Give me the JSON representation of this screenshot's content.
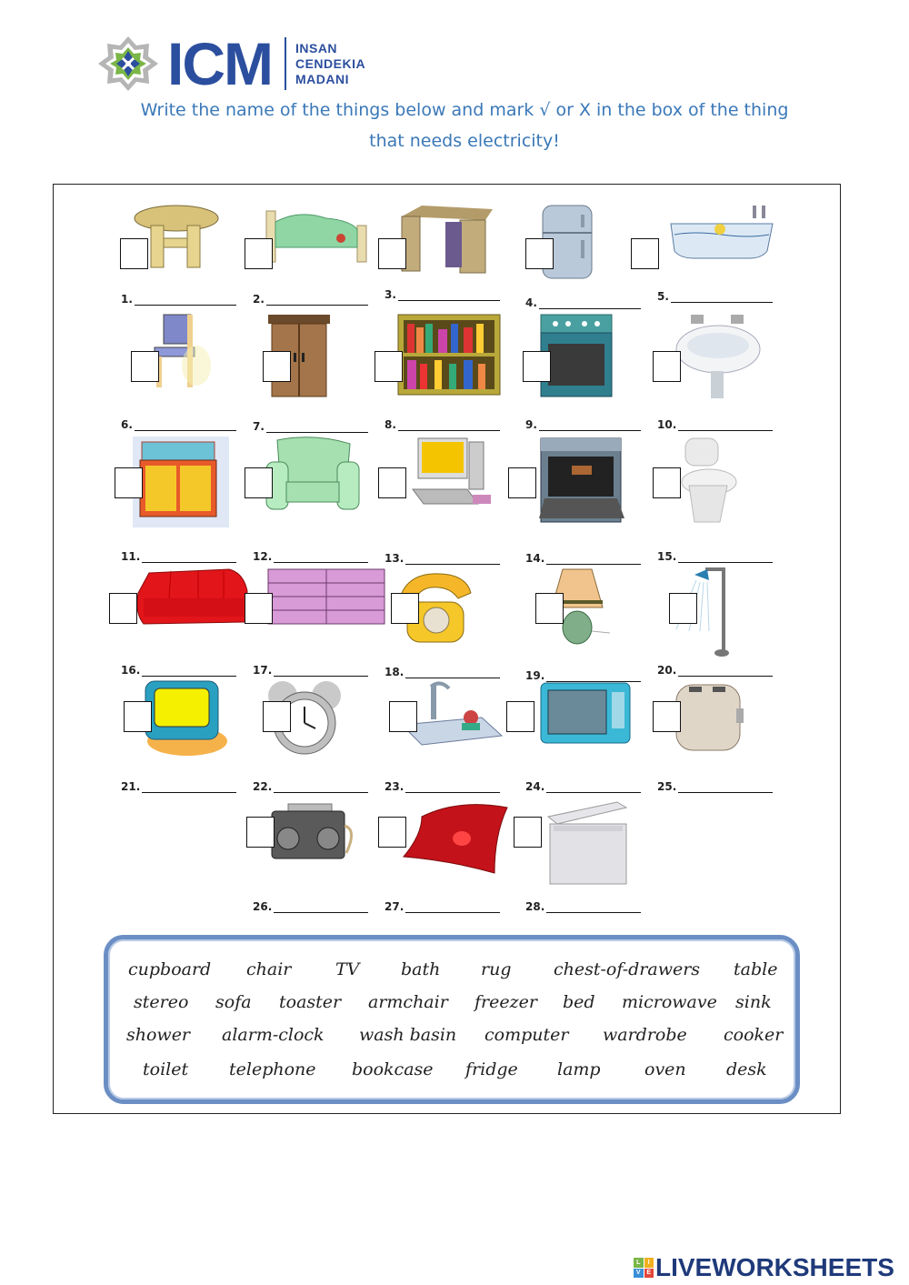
{
  "header": {
    "logo_abbr": "ICM",
    "logo_subtitle": [
      "INSAN",
      "CENDEKIA",
      "MADANI"
    ],
    "logo_icon": "star-octagon-emblem-icon",
    "instruction_line1": "Write the name of the things below and mark √ or X in the box of the thing",
    "instruction_line2": "that needs electricity!"
  },
  "colors": {
    "brand_blue": "#2b4e9e",
    "instruction_blue": "#3a78b8",
    "wordbank_border": "#6b8fc4"
  },
  "items": [
    {
      "number": "1.",
      "picture": "round-table-icon",
      "answer": "",
      "checked": ""
    },
    {
      "number": "2.",
      "picture": "bed-icon",
      "answer": "",
      "checked": ""
    },
    {
      "number": "3.",
      "picture": "desk-icon",
      "answer": "",
      "checked": ""
    },
    {
      "number": "4.",
      "picture": "fridge-icon",
      "answer": "",
      "checked": ""
    },
    {
      "number": "5.",
      "picture": "bathtub-icon",
      "answer": "",
      "checked": ""
    },
    {
      "number": "6.",
      "picture": "chair-icon",
      "answer": "",
      "checked": ""
    },
    {
      "number": "7.",
      "picture": "wardrobe-icon",
      "answer": "",
      "checked": ""
    },
    {
      "number": "8.",
      "picture": "bookcase-icon",
      "answer": "",
      "checked": ""
    },
    {
      "number": "9.",
      "picture": "cooker-icon",
      "answer": "",
      "checked": ""
    },
    {
      "number": "10.",
      "picture": "wash-basin-icon",
      "answer": "",
      "checked": ""
    },
    {
      "number": "11.",
      "picture": "cupboard-icon",
      "answer": "",
      "checked": ""
    },
    {
      "number": "12.",
      "picture": "armchair-icon",
      "answer": "",
      "checked": ""
    },
    {
      "number": "13.",
      "picture": "computer-icon",
      "answer": "",
      "checked": ""
    },
    {
      "number": "14.",
      "picture": "oven-icon",
      "answer": "",
      "checked": ""
    },
    {
      "number": "15.",
      "picture": "toilet-icon",
      "answer": "",
      "checked": ""
    },
    {
      "number": "16.",
      "picture": "sofa-icon",
      "answer": "",
      "checked": ""
    },
    {
      "number": "17.",
      "picture": "chest-of-drawers-icon",
      "answer": "",
      "checked": ""
    },
    {
      "number": "18.",
      "picture": "telephone-icon",
      "answer": "",
      "checked": ""
    },
    {
      "number": "19.",
      "picture": "lamp-icon",
      "answer": "",
      "checked": ""
    },
    {
      "number": "20.",
      "picture": "shower-icon",
      "answer": "",
      "checked": ""
    },
    {
      "number": "21.",
      "picture": "tv-icon",
      "answer": "",
      "checked": ""
    },
    {
      "number": "22.",
      "picture": "alarm-clock-icon",
      "answer": "",
      "checked": ""
    },
    {
      "number": "23.",
      "picture": "sink-icon",
      "answer": "",
      "checked": ""
    },
    {
      "number": "24.",
      "picture": "microwave-icon",
      "answer": "",
      "checked": ""
    },
    {
      "number": "25.",
      "picture": "toaster-icon",
      "answer": "",
      "checked": ""
    },
    {
      "number": "26.",
      "picture": "stereo-icon",
      "answer": "",
      "checked": ""
    },
    {
      "number": "27.",
      "picture": "rug-icon",
      "answer": "",
      "checked": ""
    },
    {
      "number": "28.",
      "picture": "freezer-icon",
      "answer": "",
      "checked": ""
    }
  ],
  "word_bank": [
    [
      "cupboard",
      "chair",
      "TV",
      "bath",
      "rug",
      "chest-of-drawers",
      "table"
    ],
    [
      "stereo",
      "sofa",
      "toaster",
      "armchair",
      "freezer",
      "bed",
      "microwave",
      "sink"
    ],
    [
      "shower",
      "alarm-clock",
      "wash basin",
      "computer",
      "wardrobe",
      "cooker"
    ],
    [
      "toilet",
      "telephone",
      "bookcase",
      "fridge",
      "lamp",
      "oven",
      "desk"
    ]
  ],
  "footer": {
    "brand": "LIVEWORKSHEETS",
    "brand_cube_letters": [
      "L",
      "I",
      "V",
      "E"
    ]
  }
}
